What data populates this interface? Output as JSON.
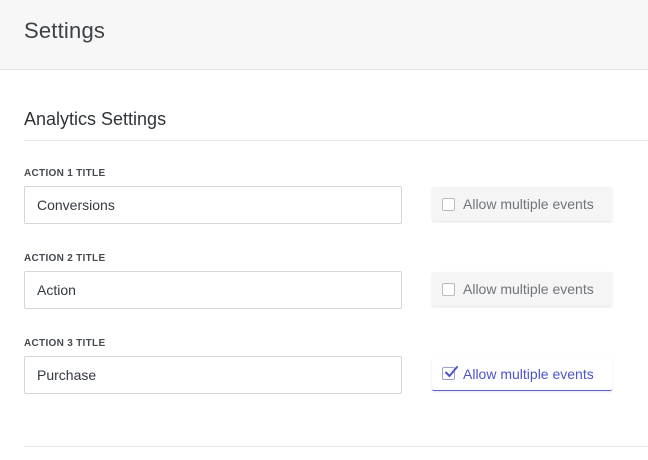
{
  "header": {
    "title": "Settings"
  },
  "section": {
    "title": "Analytics Settings"
  },
  "actions": [
    {
      "label": "ACTION 1 TITLE",
      "value": "Conversions",
      "checkbox_label": "Allow multiple events",
      "checked": false
    },
    {
      "label": "ACTION 2 TITLE",
      "value": "Action",
      "checkbox_label": "Allow multiple events",
      "checked": false
    },
    {
      "label": "ACTION 3 TITLE",
      "value": "Purchase",
      "checkbox_label": "Allow multiple events",
      "checked": true
    }
  ],
  "colors": {
    "accent": "#4c54c9",
    "header_bg": "#f7f7f7",
    "border": "#d4d7da"
  },
  "icons": {
    "check": "checkmark-icon"
  }
}
